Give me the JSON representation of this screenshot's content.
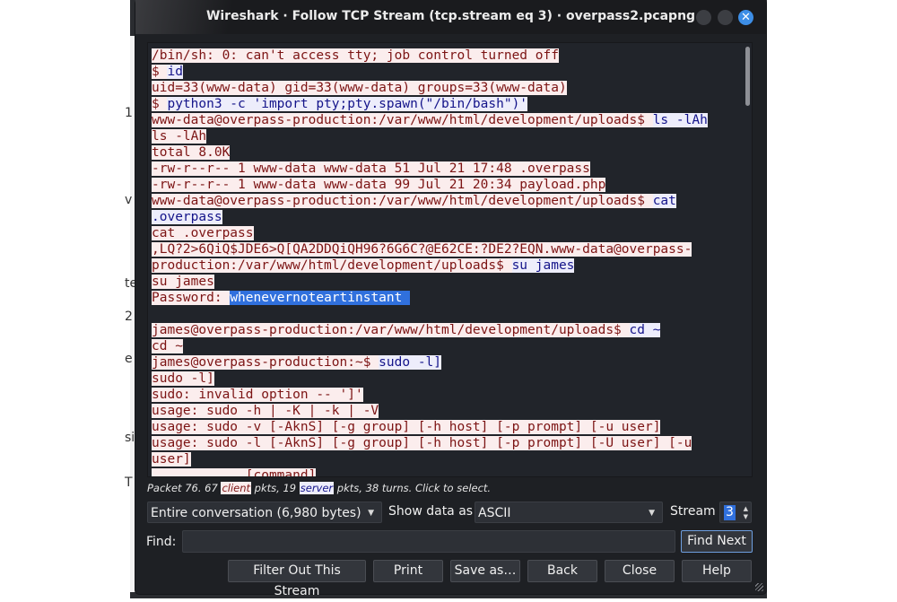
{
  "background": {
    "edge_letters": [
      "1",
      "v",
      "te",
      "2",
      "e",
      "si",
      "T"
    ]
  },
  "window": {
    "title": "Wireshark · Follow TCP Stream (tcp.stream eq 3) · overpass2.pcapng",
    "close_glyph": "✕"
  },
  "stream_lines": [
    [
      {
        "t": "c",
        "text": "/bin/sh: 0: can't access tty; job control turned off"
      }
    ],
    [
      {
        "t": "c",
        "text": "$ "
      },
      {
        "t": "s",
        "text": "id"
      }
    ],
    [
      {
        "t": "c",
        "text": "uid=33(www-data) gid=33(www-data) groups=33(www-data)"
      }
    ],
    [
      {
        "t": "c",
        "text": "$ "
      },
      {
        "t": "s",
        "text": "python3 -c 'import pty;pty.spawn(\"/bin/bash\")'"
      }
    ],
    [
      {
        "t": "c",
        "text": "www-data@overpass-production:/var/www/html/development/uploads$ "
      },
      {
        "t": "s",
        "text": "ls -lAh"
      }
    ],
    [
      {
        "t": "c",
        "text": "ls -lAh"
      }
    ],
    [
      {
        "t": "c",
        "text": "total 8.0K"
      }
    ],
    [
      {
        "t": "c",
        "text": "-rw-r--r-- 1 www-data www-data 51 Jul 21 17:48 .overpass"
      }
    ],
    [
      {
        "t": "c",
        "text": "-rw-r--r-- 1 www-data www-data 99 Jul 21 20:34 payload.php"
      }
    ],
    [
      {
        "t": "c",
        "text": "www-data@overpass-production:/var/www/html/development/uploads$ "
      },
      {
        "t": "s",
        "text": "cat"
      }
    ],
    [
      {
        "t": "s",
        "text": ".overpass"
      }
    ],
    [
      {
        "t": "c",
        "text": "cat .overpass"
      }
    ],
    [
      {
        "t": "c",
        "text": ",LQ?2>6QiQ$JDE6>Q[QA2DDQiQH96?6G6C?@E62CE:?DE2?EQN.www-data@overpass-"
      }
    ],
    [
      {
        "t": "c",
        "text": "production:/var/www/html/development/uploads$ "
      },
      {
        "t": "s",
        "text": "su james"
      }
    ],
    [
      {
        "t": "c",
        "text": "su james"
      }
    ],
    [
      {
        "t": "c",
        "text": "Password: "
      },
      {
        "t": "sel",
        "text": "whenevernoteartinstant "
      }
    ],
    [],
    [
      {
        "t": "c",
        "text": "james@overpass-production:/var/www/html/development/uploads$ "
      },
      {
        "t": "s",
        "text": "cd ~"
      }
    ],
    [
      {
        "t": "c",
        "text": "cd ~"
      }
    ],
    [
      {
        "t": "c",
        "text": "james@overpass-production:~$ "
      },
      {
        "t": "s",
        "text": "sudo -l]"
      }
    ],
    [
      {
        "t": "c",
        "text": "sudo -l]"
      }
    ],
    [
      {
        "t": "c",
        "text": "sudo: invalid option -- ']'"
      }
    ],
    [
      {
        "t": "c",
        "text": "usage: sudo -h | -K | -k | -V"
      }
    ],
    [
      {
        "t": "c",
        "text": "usage: sudo -v [-AknS] [-g group] [-h host] [-p prompt] [-u user]"
      }
    ],
    [
      {
        "t": "c",
        "text": "usage: sudo -l [-AknS] [-g group] [-h host] [-p prompt] [-U user] [-u"
      }
    ],
    [
      {
        "t": "c",
        "text": "user]"
      }
    ],
    [
      {
        "t": "c",
        "text": "            [command]"
      }
    ]
  ],
  "stats": {
    "prefix": "Packet 76. 67 ",
    "client_label": "client",
    "middle": " pkts, 19 ",
    "server_label": "server",
    "suffix": " pkts, 38 turns. Click to select."
  },
  "controls": {
    "conversation_select": "Entire conversation (6,980 bytes)",
    "show_data_label": "Show data as",
    "show_data_value": "ASCII",
    "stream_label": "Stream",
    "stream_value": "3",
    "find_label": "Find:",
    "find_value": "",
    "find_next": "Find Next"
  },
  "buttons": {
    "filter_out": "Filter Out This Stream",
    "print": "Print",
    "save_as": "Save as…",
    "back": "Back",
    "close": "Close",
    "help": "Help"
  },
  "colors": {
    "client_bg": "#fbeded",
    "client_fg": "#7c1414",
    "server_bg": "#ededfb",
    "server_fg": "#14148a",
    "selection": "#3070dd"
  }
}
